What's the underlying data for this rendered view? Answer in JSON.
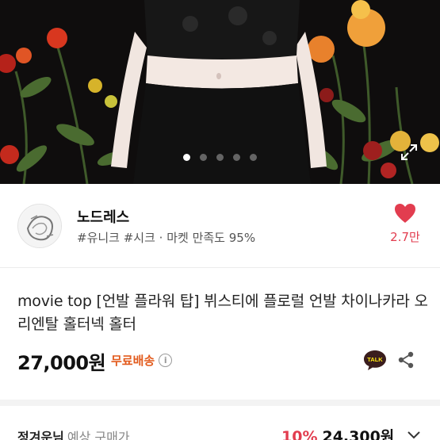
{
  "carousel": {
    "dots": 5,
    "active_index": 0
  },
  "shop": {
    "name": "노드레스",
    "tags": "#유니크 #시크 · 마켓 만족도 95%",
    "like_count": "2.7만"
  },
  "product": {
    "title": "movie top [언발 플라워 탑] 뷔스티에 플로럴 언발 차이나카라 오리엔탈 홀터넥 홀터",
    "price": "27,000원",
    "shipping_label": "무료배송",
    "info_symbol": "i",
    "talk_label": "TALK"
  },
  "member": {
    "label": "정겨운님",
    "sub": "예상 구매가",
    "discount_rate": "10%",
    "discount_price": "24,300원"
  },
  "colors": {
    "accent_red": "#e23d4f",
    "shipping_orange": "#e25a1c"
  },
  "icons": [
    "expand-icon",
    "heart-icon",
    "info-icon",
    "talk-icon",
    "share-icon",
    "chevron-down-icon"
  ]
}
